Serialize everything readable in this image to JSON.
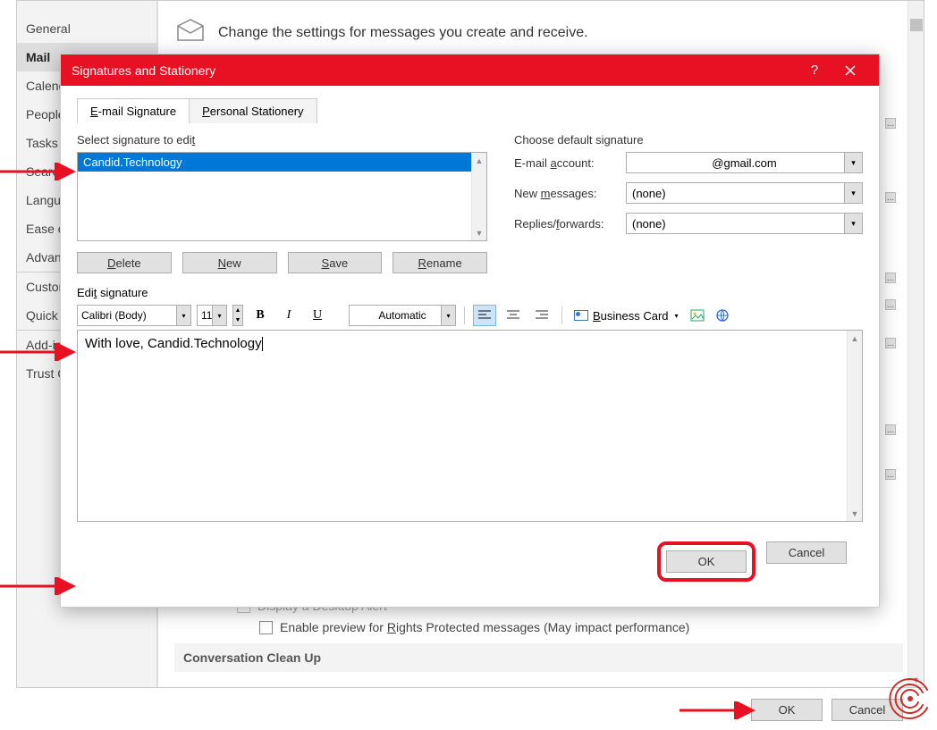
{
  "bg": {
    "sidebar": {
      "items": [
        "General",
        "Mail",
        "Calendar",
        "People",
        "Tasks",
        "Search",
        "Language",
        "Ease of Access",
        "Advanced",
        "Customize Ribbon",
        "Quick Access Toolbar",
        "Add-ins",
        "Trust Center"
      ],
      "selected_index": 1
    },
    "header_text": "Change the settings for messages you create and receive.",
    "checkbox1": "Display a Desktop Alert",
    "checkbox2_pre": "Enable preview for ",
    "checkbox2_u": "R",
    "checkbox2_post": "ights Protected messages (May impact performance)",
    "section": "Conversation Clean Up",
    "ok": "OK",
    "cancel": "Cancel"
  },
  "dialog": {
    "title": "Signatures and Stationery",
    "tabs": {
      "t1_u": "E",
      "t1_rest": "-mail Signature",
      "t2_u": "P",
      "t2_rest": "ersonal Stationery"
    },
    "select_label_pre": "Select signature to edi",
    "select_label_u": "t",
    "signature_items": [
      "Candid.Technology"
    ],
    "btn_delete_u": "D",
    "btn_delete_rest": "elete",
    "btn_new_u": "N",
    "btn_new_rest": "ew",
    "btn_save_u": "S",
    "btn_save_rest": "ave",
    "btn_rename_u": "R",
    "btn_rename_rest": "ename",
    "choose_label": "Choose default signature",
    "email_pre": "E-mail ",
    "email_u": "a",
    "email_post": "ccount:",
    "email_value": "@gmail.com",
    "newmsg_pre": "New ",
    "newmsg_u": "m",
    "newmsg_post": "essages:",
    "newmsg_value": "(none)",
    "replies_pre": "Replies/",
    "replies_u": "f",
    "replies_post": "orwards:",
    "replies_value": "(none)",
    "edit_label_pre": "Edi",
    "edit_label_u": "t",
    "edit_label_post": " signature",
    "font": "Calibri (Body)",
    "size": "11",
    "color": "Automatic",
    "bcard_u": "B",
    "bcard_rest": "usiness Card",
    "editor_text": "With love, Candid.Technology",
    "ok": "OK",
    "cancel": "Cancel"
  }
}
